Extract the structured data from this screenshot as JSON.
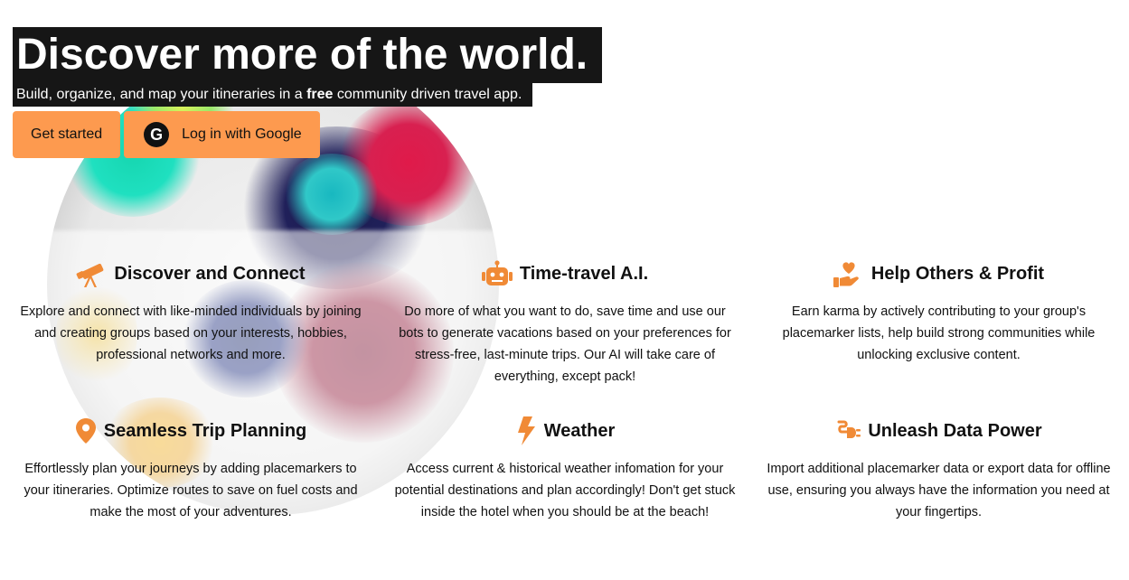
{
  "hero": {
    "title": "Discover more of the world.",
    "subtitle_before": "Build, organize, and map your itineraries in a ",
    "subtitle_bold": "free",
    "subtitle_after": " community driven travel app."
  },
  "buttons": {
    "get_started": "Get started",
    "google_icon": "G",
    "google_login": "Log in with Google"
  },
  "colors": {
    "accent": "#fd9a4f",
    "icon": "#f08a36",
    "hero_bg": "#161616"
  },
  "features": [
    {
      "icon": "telescope-icon",
      "title": "Discover and Connect",
      "text": "Explore and connect with like-minded individuals by joining and creating groups based on your interests, hobbies, professional networks and more."
    },
    {
      "icon": "robot-icon",
      "title": "Time-travel A.I.",
      "text": "Do more of what you want to do, save time and use our bots to generate vacations based on your preferences for stress-free, last-minute trips. Our AI will take care of everything, except pack!"
    },
    {
      "icon": "hand-heart-icon",
      "title": "Help Others & Profit",
      "text": "Earn karma by actively contributing to your group's placemarker lists, help build strong communities while unlocking exclusive content."
    },
    {
      "icon": "map-pin-icon",
      "title": "Seamless Trip Planning",
      "text": "Effortlessly plan your journeys by adding placemarkers to your itineraries. Optimize routes to save on fuel costs and make the most of your adventures."
    },
    {
      "icon": "lightning-icon",
      "title": "Weather",
      "text": "Access current & historical weather infomation for your potential destinations and plan accordingly! Don't get stuck inside the hotel when you should be at the beach!"
    },
    {
      "icon": "plug-icon",
      "title": "Unleash Data Power",
      "text": "Import additional placemarker data or export data for offline use, ensuring you always have the information you need at your fingertips."
    }
  ]
}
